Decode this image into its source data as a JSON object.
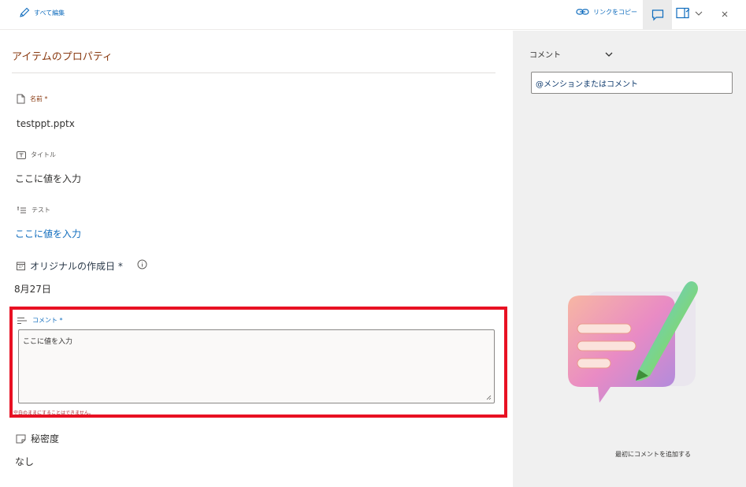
{
  "toolbar": {
    "edit_all": "すべて編集",
    "copy_link": "リンクをコピー",
    "icons": [
      "pencil-icon",
      "link-icon",
      "comment-icon",
      "details-pane-icon",
      "chevron-down-icon",
      "close-icon"
    ]
  },
  "properties": {
    "title": "アイテムのプロパティ",
    "fields": [
      {
        "label": "名前 *",
        "value": "testppt.pptx",
        "icon": "document-icon"
      },
      {
        "label": "タイトル",
        "value": "ここに値を入力",
        "icon": "text-title-icon"
      },
      {
        "label": "テスト",
        "value": "ここに値を入力",
        "icon": "text-list-icon"
      },
      {
        "label": "オリジナルの作成日 *",
        "value": "8月27日",
        "icon": "calendar-icon"
      },
      {
        "label": "コメント *",
        "value": "ここに値を入力",
        "icon": "multiline-text-icon",
        "error": "空白のままにすることはできません。"
      },
      {
        "label": "秘密度",
        "value": "なし",
        "icon": "sensitivity-icon"
      }
    ]
  },
  "comments_panel": {
    "dropdown": "コメント",
    "input_placeholder": "@メンションまたはコメント",
    "empty_message": "最初にコメントを追加する"
  },
  "colors": {
    "accent": "#0f6cbd",
    "label": "#8a3b12",
    "error": "#e81123",
    "panel_bg": "#f0f0f0"
  }
}
